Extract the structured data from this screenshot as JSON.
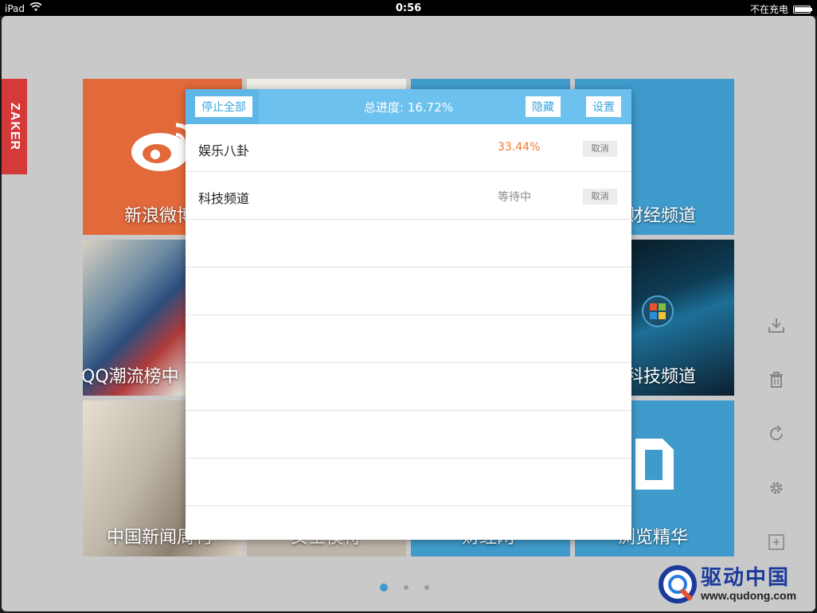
{
  "status_bar": {
    "device": "iPad",
    "time": "0:56",
    "charging": "不在充电"
  },
  "brand": {
    "tab_label": "ZAKER"
  },
  "tiles": [
    {
      "label": "新浪微博"
    },
    {
      "label": ""
    },
    {
      "label": ""
    },
    {
      "label": "财经频道"
    },
    {
      "label": "QQ潮流榜中"
    },
    {
      "label": "科技频道"
    },
    {
      "label": "中国新闻周刊"
    },
    {
      "label": "女士模特"
    },
    {
      "label": "财经网"
    },
    {
      "label": "浏览精华"
    }
  ],
  "dialog": {
    "stop_all_label": "停止全部",
    "title": "总进度: 16.72%",
    "hide_label": "隐藏",
    "settings_label": "设置",
    "items": [
      {
        "name": "娱乐八卦",
        "status": "33.44%",
        "cancel_label": "取消"
      },
      {
        "name": "科技频道",
        "status": "等待中",
        "cancel_label": "取消"
      }
    ]
  },
  "side_tools": [
    "download-icon",
    "trash-icon",
    "refresh-icon",
    "gear-icon",
    "add-icon"
  ],
  "pagination": {
    "pages": 3,
    "current": 1
  },
  "watermark": {
    "title": "驱动中国",
    "url": "www.qudong.com"
  },
  "colors": {
    "accent_blue": "#3f9bcc",
    "dialog_header": "#6dc1ee",
    "progress_orange": "#ef7b2c",
    "brand_red": "#d53a3a",
    "tile_orange": "#e2693a"
  }
}
